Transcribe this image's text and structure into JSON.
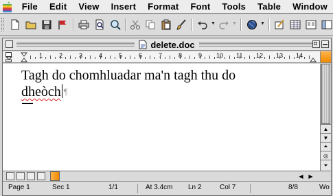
{
  "menubar": {
    "items": [
      "File",
      "Edit",
      "View",
      "Insert",
      "Format",
      "Font",
      "Tools",
      "Table",
      "Window"
    ]
  },
  "window": {
    "title": "delete.doc"
  },
  "ruler": {
    "labels": [
      "1",
      "2",
      "3",
      "4",
      "5",
      "6",
      "7",
      "8",
      "9",
      "10",
      "11",
      "12",
      "13",
      "14"
    ]
  },
  "document": {
    "line1": "Tagh do chomhluadar ma'n tagh thu do",
    "line2_word": "dheòch",
    "paragraph_mark": "¶"
  },
  "status": {
    "page": "Page 1",
    "section": "Sec 1",
    "page_of": "1/1",
    "at": "At 3.4cm",
    "line": "Ln 2",
    "col": "Col 7",
    "count": "8/8",
    "mode": "Wo"
  },
  "colors": {
    "accent_orange": "#f08a00",
    "spell_error": "#e02020"
  }
}
